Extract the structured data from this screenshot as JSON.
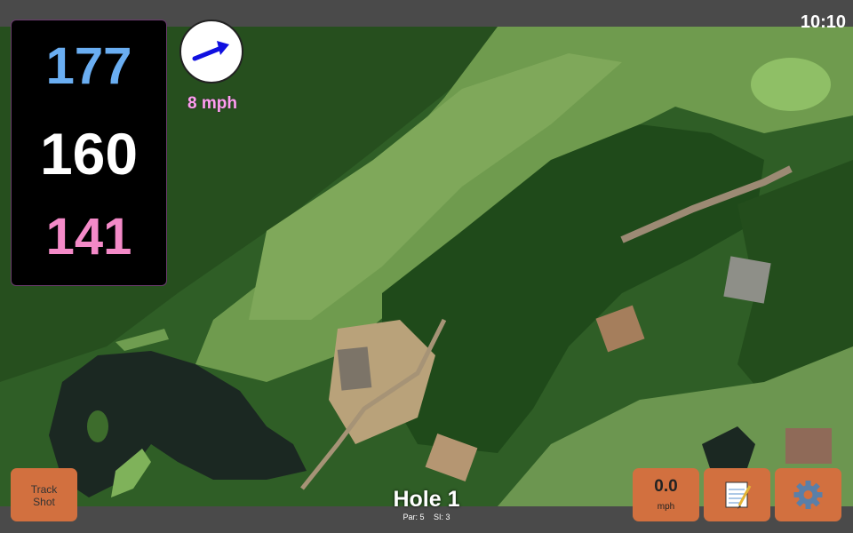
{
  "status": {
    "time": "10:10"
  },
  "distances": {
    "back": "177",
    "middle": "160",
    "front": "141",
    "colors": {
      "back": "#6aaef2",
      "middle": "#ffffff",
      "front": "#f48ac8"
    }
  },
  "wind": {
    "speed_label": "8 mph",
    "icon": "wind-direction-arrow-icon",
    "arrow_color": "#1010e0"
  },
  "buttons": {
    "track_shot_line1": "Track",
    "track_shot_line2": "Shot",
    "speed_value": "0.0",
    "speed_unit": "mph",
    "notes_icon": "notepad-icon",
    "settings_icon": "gear-icon",
    "accent": "#d2703f"
  },
  "hole": {
    "title": "Hole 1",
    "par": "Par: 5",
    "si": "SI: 3"
  }
}
